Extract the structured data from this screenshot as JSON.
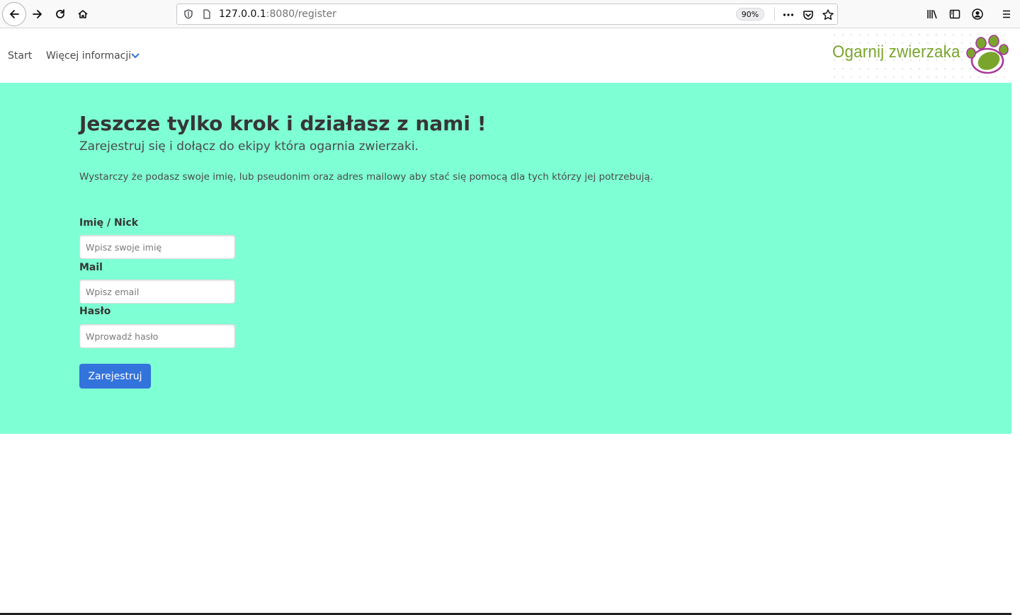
{
  "browser": {
    "url_host": "127.0.0.1",
    "url_path": ":8080/register",
    "zoom": "90%"
  },
  "nav": {
    "start_label": "Start",
    "more_label": "Więcej informacji",
    "logo_text": "Ogarnij zwierzaka"
  },
  "hero": {
    "title": "Jeszcze tylko krok i działasz z nami !",
    "subtitle": "Zarejestruj się i dołącz do ekipy która ogarnia zwierzaki.",
    "description": "Wystarczy że podasz swoje imię, lub pseudonim oraz adres mailowy aby stać się pomocą dla tych którzy jej potrzebują."
  },
  "form": {
    "name_label": "Imię / Nick",
    "name_placeholder": "Wpisz swoje imię",
    "email_label": "Mail",
    "email_placeholder": "Wpisz email",
    "password_label": "Hasło",
    "password_placeholder": "Wprowadź hasło",
    "submit_label": "Zarejestruj"
  },
  "colors": {
    "hero_bg": "#7fffd4",
    "primary": "#3273dc",
    "logo_green": "#7aa52c",
    "logo_purple": "#a8389a"
  },
  "icons": {
    "back": "arrow-left-icon",
    "forward": "arrow-right-icon",
    "reload": "reload-icon",
    "home": "home-icon",
    "shield": "shield-icon",
    "page": "page-icon",
    "more": "ellipsis-icon",
    "pocket": "pocket-icon",
    "bookmark": "star-icon",
    "library": "library-icon",
    "sidebar": "sidebar-icon",
    "account": "account-icon",
    "menu": "hamburger-menu-icon",
    "chevron": "chevron-down-icon",
    "paw": "paw-icon"
  }
}
